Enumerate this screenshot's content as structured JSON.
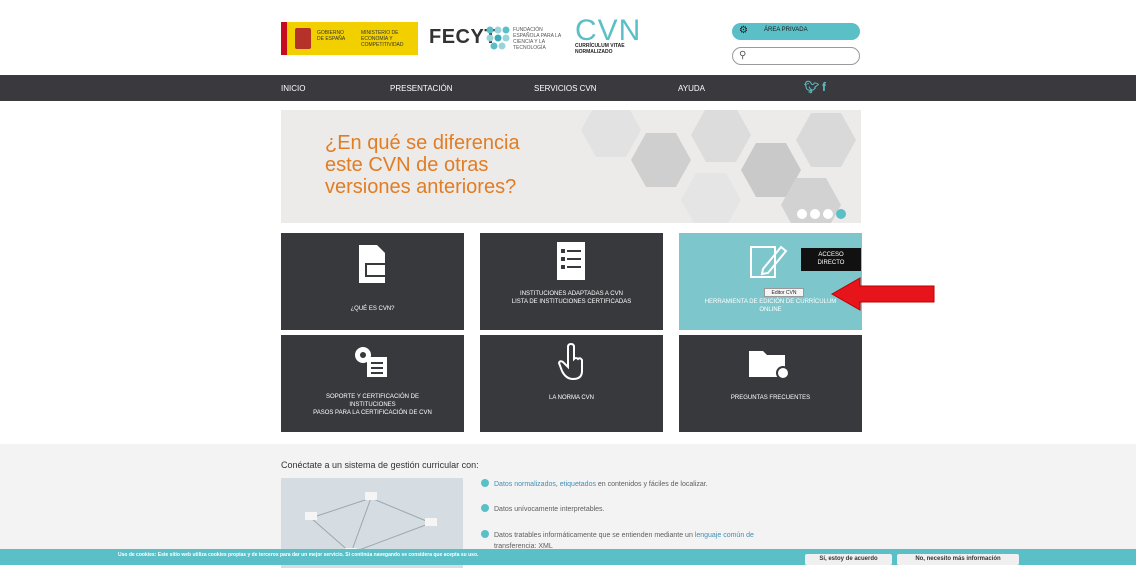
{
  "header": {
    "gobierno_text": "GOBIERNO DE ESPAÑA",
    "ministerio_text": "MINISTERIO DE ECONOMÍA Y COMPETITIVIDAD",
    "fecyt_logo": "FECYT",
    "fecyt_sub": "FUNDACIÓN ESPAÑOLA PARA LA CIENCIA Y LA TECNOLOGÍA",
    "cvn_logo": "CVN",
    "cvn_sub": "CURRÍCULUM VITAE NORMALIZADO",
    "area_privada": "ÁREA PRIVADA",
    "search_icon": "search-icon",
    "area_icon": "gear-icon"
  },
  "nav": {
    "items": [
      "INICIO",
      "PRESENTACIÓN",
      "SERVICIOS CVN",
      "AYUDA"
    ],
    "social": [
      "twitter-icon",
      "facebook-icon"
    ]
  },
  "hero": {
    "line1": "¿En qué se diferencia",
    "line2": "este CVN de otras",
    "line3": "versiones anteriores?",
    "slides": 4,
    "active_slide": 4
  },
  "tiles": {
    "t1": {
      "caption": "¿QUÉ ES CVN?",
      "icon": "document-icon"
    },
    "t2": {
      "line1": "INSTITUCIONES ADAPTADAS A CVN",
      "line2": "LISTA DE INSTITUCIONES CERTIFICADAS",
      "icon": "list-icon"
    },
    "t3": {
      "line1": "EDI",
      "line2": "HERRAMIENTA DE EDICIÓN DE CURRÍCULUM",
      "line3": "ONLINE",
      "icon": "edit-icon"
    },
    "t4": {
      "line1": "SOPORTE Y CERTIFICACIÓN DE",
      "line2": "INSTITUCIONES",
      "line3": "PASOS PARA LA CERTIFICACIÓN DE CVN",
      "icon": "settings-icon"
    },
    "t5": {
      "caption": "LA NORMA CVN",
      "icon": "hand-pointer-icon"
    },
    "t6": {
      "caption": "PREGUNTAS FRECUENTES",
      "icon": "folder-search-icon"
    },
    "acceso_line1": "ACCESO",
    "acceso_line2": "DIRECTO",
    "tooltip": "Editor CVN"
  },
  "bottom": {
    "heading": "Conéctate a un sistema de gestión curricular con:",
    "b1_link1": "Datos normalizados",
    "b1_sep": ", ",
    "b1_link2": "etiquetados",
    "b1_rest": " en contenidos y fáciles de localizar.",
    "b2": "Datos unívocamente interpretables.",
    "b3_pre": "Datos tratables informáticamente que se entienden mediante un ",
    "b3_link": "lenguaje común de",
    "b3_cont": "transferencia: XML"
  },
  "cookie": {
    "text": "Uso de cookies: Este sitio web utiliza cookies propias y de terceros para dar un mejor servicio. Si continúa navegando se considera que acepta su uso.",
    "accept": "Sí, estoy de acuerdo",
    "more": "No, necesito más información"
  },
  "colors": {
    "teal": "#5bbfc8",
    "dark": "#38393d",
    "orange": "#e07d25",
    "arrow": "#e8141b"
  }
}
